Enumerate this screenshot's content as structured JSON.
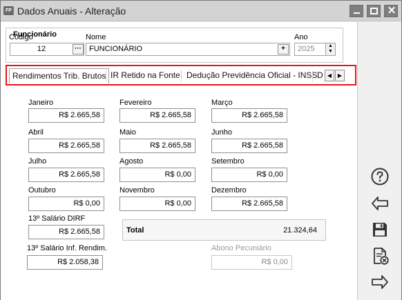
{
  "window": {
    "app_icon_text": "FP",
    "title": "Dados Anuais - Alteração"
  },
  "funcionario": {
    "group_title": "Funcionário",
    "codigo_label": "Código",
    "codigo_value": "12",
    "nome_label": "Nome",
    "nome_value": "FUNCIONÁRIO",
    "ano_label": "Ano",
    "ano_value": "2025"
  },
  "tabs": [
    {
      "label": "Rendimentos Trib. Brutos",
      "active": true
    },
    {
      "label": "IR Retido na Fonte",
      "active": false
    },
    {
      "label": "Dedução Previdência Oficial - INSS",
      "active": false
    },
    {
      "label": "D",
      "active": false
    }
  ],
  "months": [
    {
      "label": "Janeiro",
      "value": "R$ 2.665,58"
    },
    {
      "label": "Fevereiro",
      "value": "R$ 2.665,58"
    },
    {
      "label": "Março",
      "value": "R$ 2.665,58"
    },
    {
      "label": "Abril",
      "value": "R$ 2.665,58"
    },
    {
      "label": "Maio",
      "value": "R$ 2.665,58"
    },
    {
      "label": "Junho",
      "value": "R$ 2.665,58"
    },
    {
      "label": "Julho",
      "value": "R$ 2.665,58"
    },
    {
      "label": "Agosto",
      "value": "R$ 0,00"
    },
    {
      "label": "Setembro",
      "value": "R$ 0,00"
    },
    {
      "label": "Outubro",
      "value": "R$ 0,00"
    },
    {
      "label": "Novembro",
      "value": "R$ 0,00"
    },
    {
      "label": "Dezembro",
      "value": "R$ 2.665,58"
    }
  ],
  "decimo_dirf": {
    "label": "13º Salário DIRF",
    "value": "R$ 2.665,58"
  },
  "decimo_rendim": {
    "label": "13º Salário Inf. Rendim.",
    "value": "R$ 2.058,38"
  },
  "total": {
    "label": "Total",
    "value": "21.324,64"
  },
  "abono": {
    "label": "Abono Pecuniário",
    "value": "R$ 0,00"
  },
  "sidebar": [
    {
      "icon": "help-icon"
    },
    {
      "icon": "back-arrow-icon"
    },
    {
      "icon": "save-icon"
    },
    {
      "icon": "cancel-document-icon"
    },
    {
      "icon": "forward-arrow-icon"
    }
  ]
}
